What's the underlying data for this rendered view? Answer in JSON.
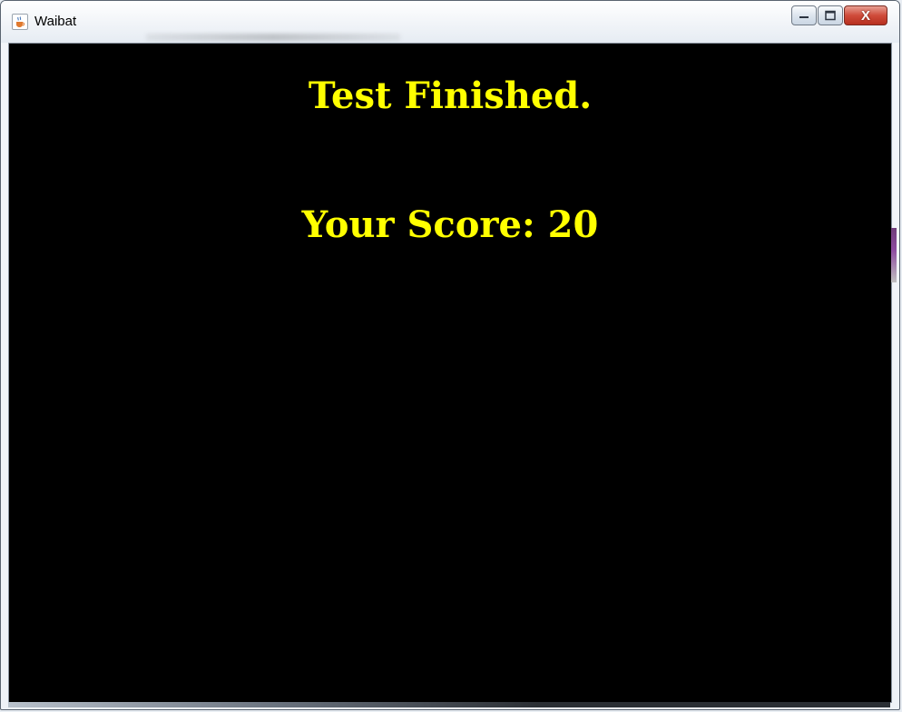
{
  "window": {
    "title": "Waibat",
    "icon": "java-cup-icon",
    "controls": {
      "minimize_icon": "minimize-icon",
      "maximize_icon": "maximize-icon",
      "close_label": "X"
    }
  },
  "content": {
    "heading": "Test Finished.",
    "score_text": "Your Score: 20",
    "text_color": "#ffff00",
    "background_color": "#000000"
  }
}
